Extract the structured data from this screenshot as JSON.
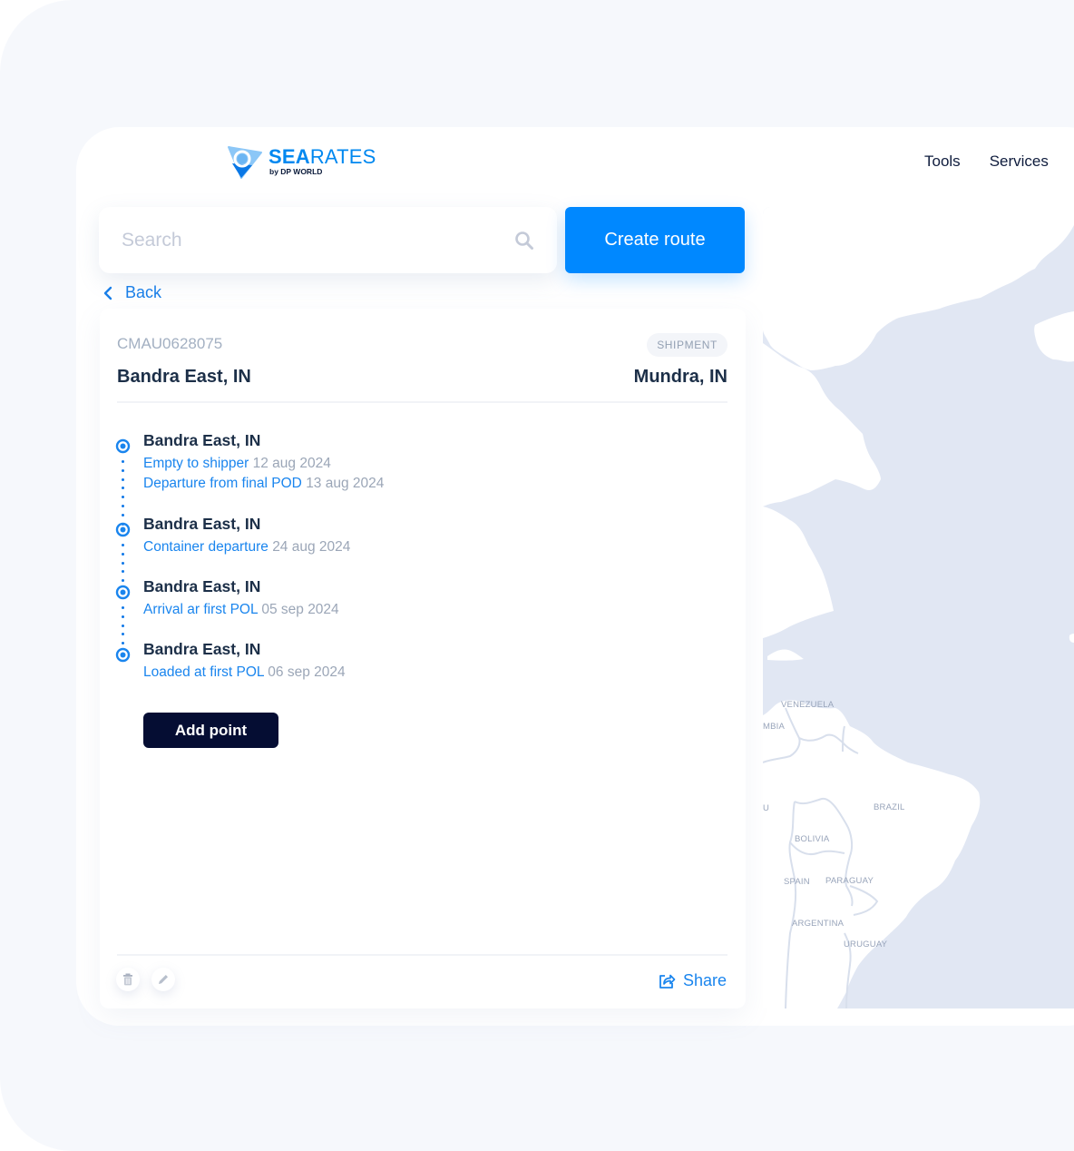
{
  "brand": {
    "name_bold": "SEA",
    "name_light": "RATES",
    "tagline": "by DP WORLD",
    "primary_color": "#0088ff",
    "dark_color": "#050d33"
  },
  "nav": {
    "items": [
      {
        "label": "Tools"
      },
      {
        "label": "Services"
      }
    ]
  },
  "search": {
    "placeholder": "Search",
    "value": "",
    "icon": "search-icon"
  },
  "toolbar": {
    "create_route_label": "Create route",
    "back_label": "Back"
  },
  "shipment": {
    "container_id": "CMAU0628075",
    "badge": "SHIPMENT",
    "origin": "Bandra East, IN",
    "destination": "Mundra, IN",
    "points": [
      {
        "location": "Bandra East, IN",
        "events": [
          {
            "name": "Empty to shipper",
            "date": "12 aug 2024"
          },
          {
            "name": "Departure from final POD",
            "date": "13 aug 2024"
          }
        ]
      },
      {
        "location": "Bandra East, IN",
        "events": [
          {
            "name": "Container departure",
            "date": " 24 aug 2024"
          }
        ]
      },
      {
        "location": "Bandra East, IN",
        "events": [
          {
            "name": "Arrival ar first POL",
            "date": "05 sep 2024"
          }
        ]
      },
      {
        "location": "Bandra East, IN",
        "events": [
          {
            "name": "Loaded at first POL",
            "date": "06 sep 2024"
          }
        ]
      }
    ],
    "add_point_label": "Add point",
    "share_label": "Share",
    "actions": [
      "trash-icon",
      "pencil-icon"
    ]
  },
  "map": {
    "labels": [
      {
        "text": "VENEZUELA"
      },
      {
        "text": "MBIA"
      },
      {
        "text": "U"
      },
      {
        "text": "BRAZIL"
      },
      {
        "text": "BOLIVIA"
      },
      {
        "text": "SPAIN"
      },
      {
        "text": "PARAGUAY"
      },
      {
        "text": "ARGENTINA"
      },
      {
        "text": "URUGUAY"
      }
    ]
  }
}
